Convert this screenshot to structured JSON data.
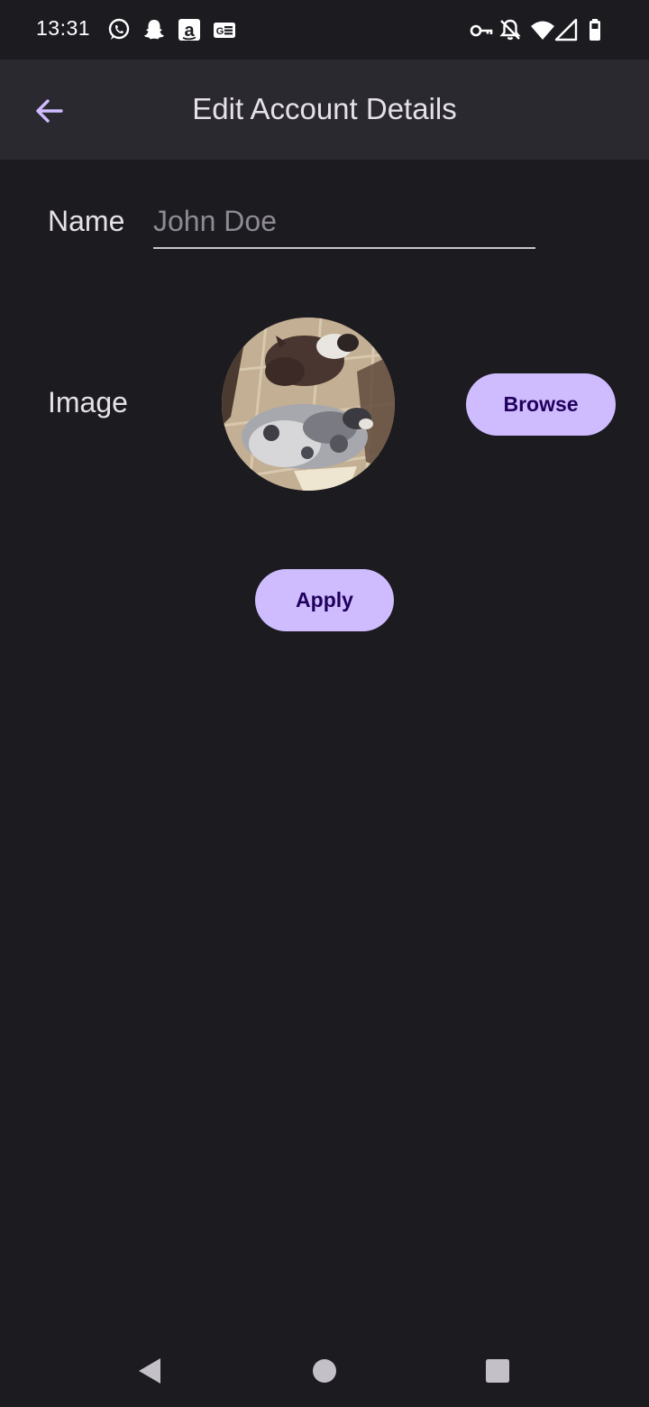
{
  "status_bar": {
    "time": "13:31",
    "left_icons": [
      "whatsapp-icon",
      "snapchat-icon",
      "amazon-icon",
      "gmail-news-icon"
    ],
    "right_icons": [
      "vpn-key-icon",
      "notifications-off-icon",
      "wifi-icon",
      "signal-icon",
      "battery-icon"
    ]
  },
  "app_bar": {
    "title": "Edit Account Details",
    "back_icon": "arrow-back-icon"
  },
  "form": {
    "name_label": "Name",
    "name_value": "",
    "name_placeholder": "John Doe",
    "image_label": "Image",
    "browse_label": "Browse",
    "apply_label": "Apply"
  },
  "nav_bar": {
    "icons": [
      "back-triangle-icon",
      "home-circle-icon",
      "recents-square-icon"
    ]
  },
  "colors": {
    "background": "#1c1b20",
    "app_bar": "#2b2930",
    "accent": "#cfbcff",
    "accent_text": "#21005d",
    "back_arrow": "#d0bcff"
  }
}
